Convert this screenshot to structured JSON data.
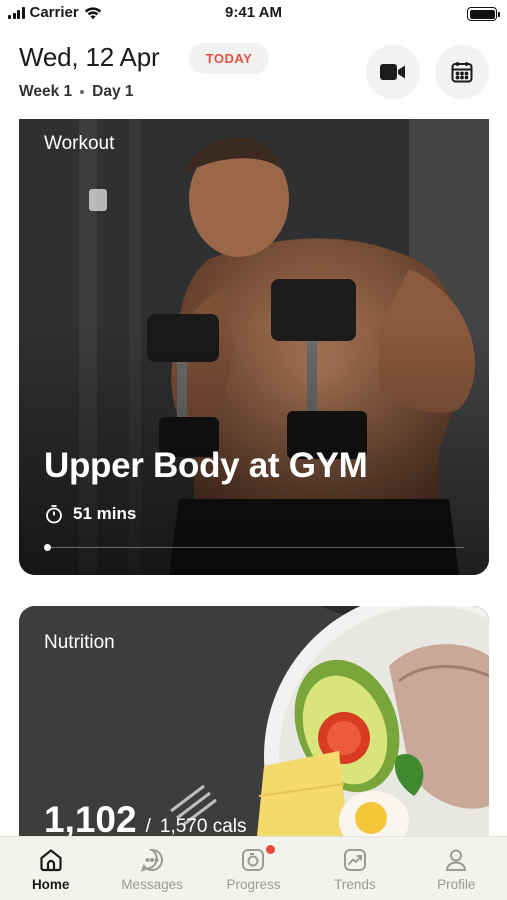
{
  "status_bar": {
    "carrier": "Carrier",
    "time": "9:41 AM"
  },
  "header": {
    "date": "Wed, 12 Apr",
    "today_badge": "TODAY",
    "week": "Week 1",
    "day": "Day 1",
    "video_button_icon": "video-camera-icon",
    "calendar_button_icon": "calendar-icon"
  },
  "workout_card": {
    "label": "Workout",
    "title": "Upper Body at GYM",
    "duration": "51 mins",
    "duration_icon": "stopwatch-icon",
    "progress": 0.0
  },
  "nutrition_card": {
    "label": "Nutrition",
    "calories": "1,102",
    "separator": "/",
    "target": "1,570 cals"
  },
  "tab_bar": {
    "tabs": [
      {
        "label": "Home",
        "icon": "home-icon",
        "active": true
      },
      {
        "label": "Messages",
        "icon": "chat-icon",
        "active": false
      },
      {
        "label": "Progress",
        "icon": "camera-progress-icon",
        "active": false,
        "badge": true
      },
      {
        "label": "Trends",
        "icon": "trend-chart-icon",
        "active": false
      },
      {
        "label": "Profile",
        "icon": "user-icon",
        "active": false
      }
    ]
  },
  "colors": {
    "accent_red": "#e0533f",
    "badge_red": "#e5483a",
    "tab_active": "#1b1b1b",
    "tab_inactive": "#9a9a9a",
    "tab_bar_bg": "#f3f3ee"
  }
}
